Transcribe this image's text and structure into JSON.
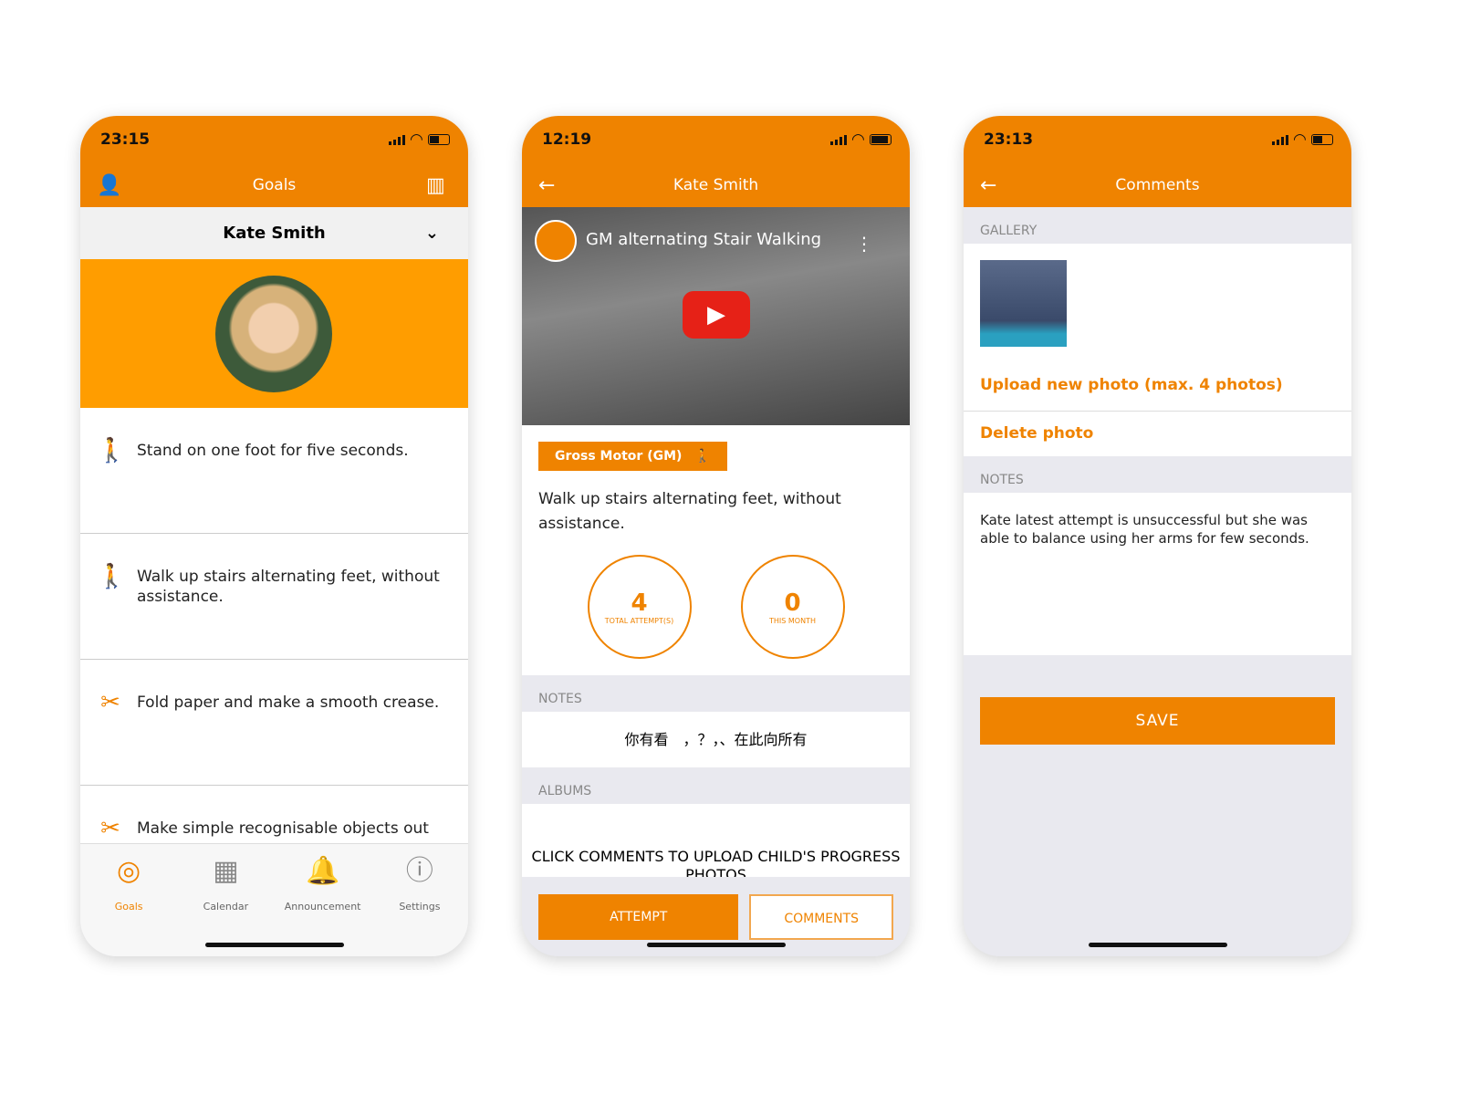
{
  "colors": {
    "accent": "#ef8300",
    "banner": "#ff9d00"
  },
  "screen1": {
    "time": "23:15",
    "title": "Goals",
    "child": "Kate Smith",
    "goals": [
      {
        "icon": "person-icon",
        "text": "Stand on one foot for five seconds."
      },
      {
        "icon": "person-icon",
        "text": "Walk up stairs alternating feet, without assistance."
      },
      {
        "icon": "scissors-icon",
        "text": "Fold paper and make a smooth crease."
      },
      {
        "icon": "scissors-icon",
        "text": "Make simple recognisable objects out"
      }
    ],
    "tabs": [
      {
        "label": "Goals",
        "icon": "target-icon"
      },
      {
        "label": "Calendar",
        "icon": "calendar-icon"
      },
      {
        "label": "Announcement",
        "icon": "bell-icon"
      },
      {
        "label": "Settings",
        "icon": "info-icon"
      }
    ]
  },
  "screen2": {
    "time": "12:19",
    "title": "Kate Smith",
    "video_title": "GM alternating Stair Walking",
    "category": "Gross Motor (GM)",
    "description": "Walk up stairs alternating feet, without assistance.",
    "total_attempts": "4",
    "total_label": "TOTAL ATTEMPT(S)",
    "month_attempts": "0",
    "month_label": "THIS MONTH",
    "notes_label": "NOTES",
    "notes": "你有看　，？，、在此向所有",
    "albums_label": "ALBUMS",
    "albums_text": "CLICK COMMENTS TO UPLOAD CHILD'S PROGRESS PHOTOS",
    "attempt": "ATTEMPT",
    "comments": "COMMENTS"
  },
  "screen3": {
    "time": "23:13",
    "title": "Comments",
    "gallery_label": "GALLERY",
    "upload": "Upload new photo (max. 4 photos)",
    "delete": "Delete photo",
    "notes_label": "NOTES",
    "notes": "Kate latest attempt is unsuccessful but she was able to balance using her arms for few seconds.",
    "save": "SAVE"
  }
}
